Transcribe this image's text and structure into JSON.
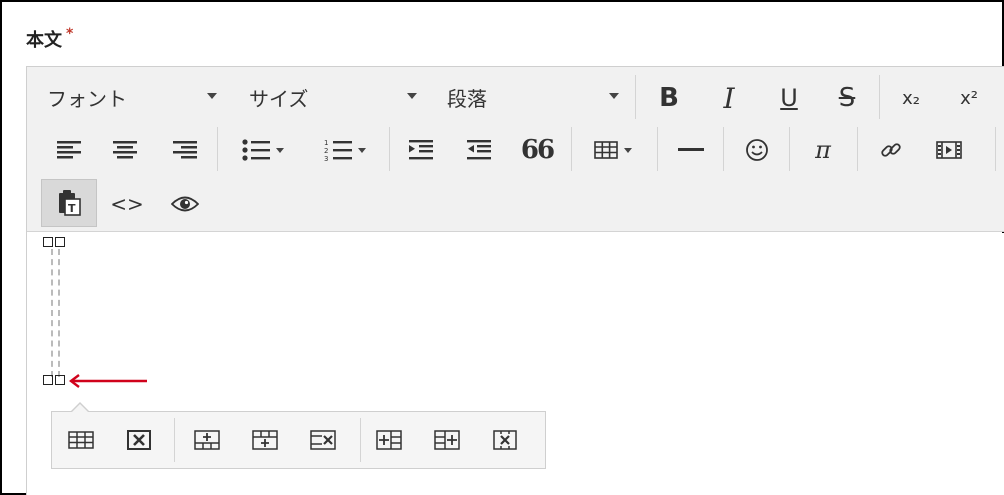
{
  "field": {
    "label": "本文",
    "required_mark": "*"
  },
  "toolbar": {
    "font_label": "フォント",
    "size_label": "サイズ",
    "paragraph_label": "段落",
    "bold": "B",
    "italic": "I",
    "underline": "U",
    "strike": "S",
    "subscript": "x₂",
    "superscript": "x²",
    "quote": "66",
    "pi": "π",
    "source": "<>"
  },
  "colors": {
    "accent_arrow": "#d0021b",
    "toolbar_bg": "#f1f1f1"
  }
}
